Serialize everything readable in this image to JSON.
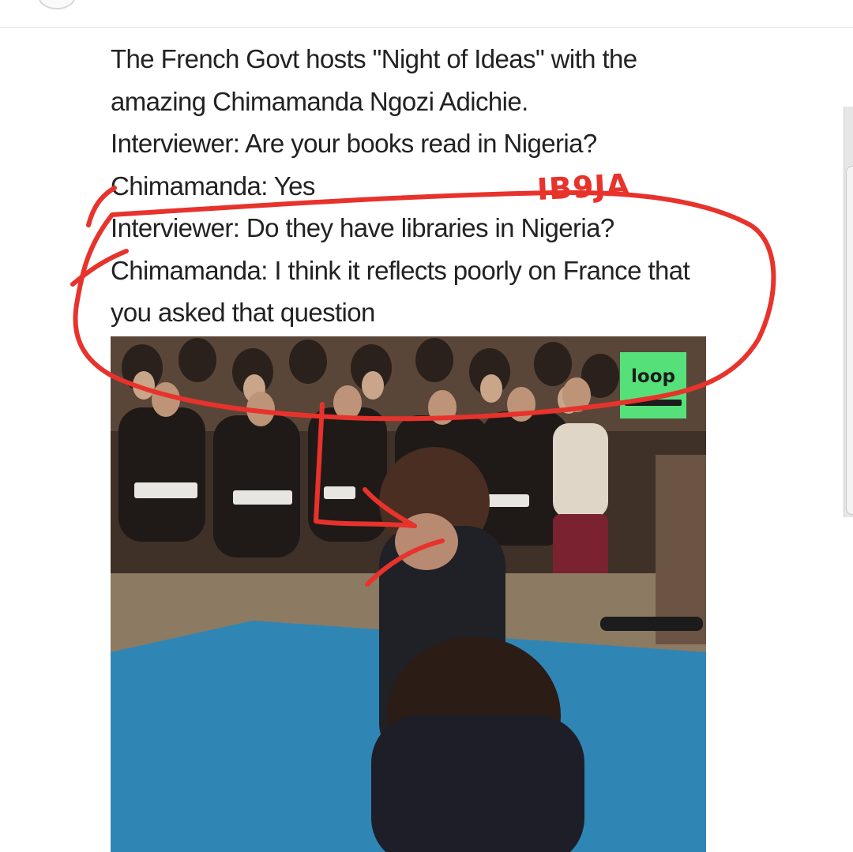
{
  "post": {
    "lines": [
      "The French Govt hosts \"Night of Ideas\" with the",
      "amazing Chimamanda Ngozi Adichie.",
      "Interviewer: Are your books read in Nigeria?",
      "Chimamanda: Yes",
      "Interviewer: Do they have libraries in Nigeria?",
      "Chimamanda: I think it reflects poorly on France that",
      "you asked that question"
    ]
  },
  "video": {
    "logo_text": "loop",
    "logo_color": "#56e07a",
    "floor_color": "#2f86b5"
  },
  "annotation": {
    "watermark": "IB9JA",
    "ink_color": "#e8322c"
  }
}
